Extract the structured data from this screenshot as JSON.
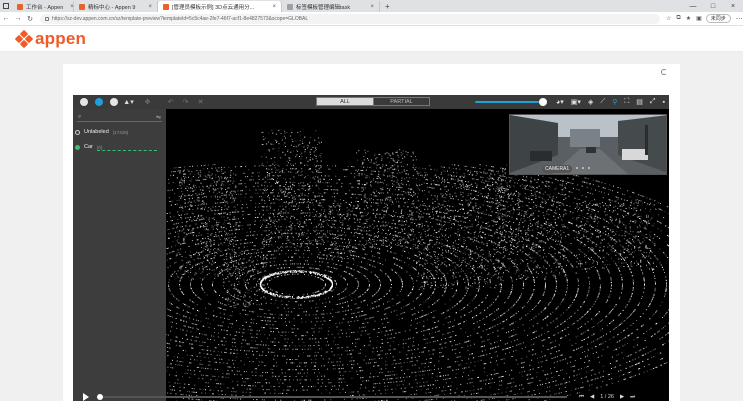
{
  "browser": {
    "tabs": [
      {
        "title": "工作台 - Appen",
        "active": false,
        "icon": "appen-icon"
      },
      {
        "title": "精标中心 - Appen 9",
        "active": false,
        "icon": "appen-icon"
      },
      {
        "title": "[管理员模板示例] 3D点云通用分...",
        "active": true,
        "icon": "appen-icon"
      },
      {
        "title": "标签模板管理编辑task",
        "active": false,
        "icon": "page-icon"
      }
    ],
    "new_tab": "+",
    "url": "https://sz-dev.appen.com.cn/sz/template-preview?templateId=5c5c4ae-2fe7-46f7-acf1-8e4827573&scope=GLOBAL",
    "sync_label": "未同步"
  },
  "app": {
    "logo_text": "appen",
    "brand_color": "#f05a28"
  },
  "toolbar": {
    "seg_all": "ALL",
    "seg_partial": "PARTIAL",
    "accent_color": "#1ea0d8"
  },
  "labels": {
    "unlabeled": {
      "name": "Unlabeled",
      "count": "(17428)"
    },
    "car": {
      "name": "Car",
      "count": "(0)"
    }
  },
  "camera": {
    "label": "CAMERA1"
  },
  "playbar": {
    "page": "1 / 26"
  }
}
